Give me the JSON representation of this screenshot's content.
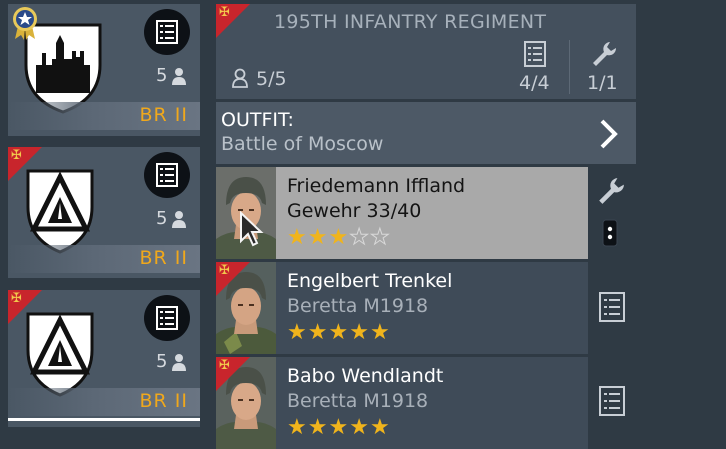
{
  "squads": [
    {
      "count": "5",
      "br": "BR II",
      "selected": true
    },
    {
      "count": "5",
      "br": "BR II"
    },
    {
      "count": "5",
      "br": "BR II"
    }
  ],
  "regiment": {
    "title": "195TH INFANTRY REGIMENT",
    "soldiers": "5/5",
    "equipment": "4/4",
    "tools": "1/1"
  },
  "outfit": {
    "label": "OUTFIT:",
    "value": "Battle of Moscow"
  },
  "soldiers": [
    {
      "name": "Friedemann Iffland",
      "weapon": "Gewehr 33/40",
      "stars": 3,
      "max_stars": 5,
      "selected": true
    },
    {
      "name": "Engelbert Trenkel",
      "weapon": "Beretta M1918",
      "stars": 5,
      "max_stars": 5
    },
    {
      "name": "Babo Wendlandt",
      "weapon": "Beretta M1918",
      "stars": 5,
      "max_stars": 5
    }
  ],
  "colors": {
    "accent": "#f0a81c",
    "flag": "#c8252c",
    "star": "#f0b41c",
    "selected_row": "#a9a9a9"
  },
  "icons": [
    "badge-icon",
    "list-icon",
    "person-icon",
    "wrench-icon",
    "rank-icon",
    "cursor-icon"
  ]
}
